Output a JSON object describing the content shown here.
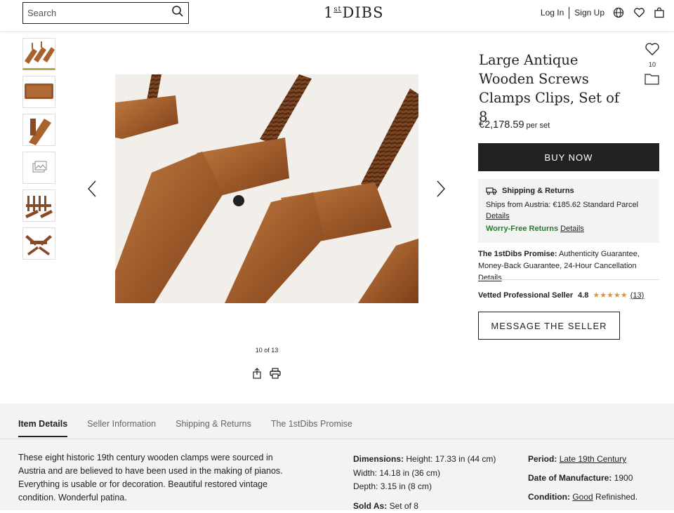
{
  "header": {
    "search_placeholder": "Search",
    "logo_main": "1",
    "logo_sup": "st",
    "logo_rest": "DIBS",
    "login": "Log In",
    "signup": "Sign Up"
  },
  "gallery": {
    "counter": "10 of 13",
    "thumb_count": 6
  },
  "product": {
    "title": "Large Antique Wooden Screws Clamps Clips, Set of 8",
    "favorites": "10",
    "price": "€2,178.59",
    "price_unit": "per set",
    "buy_label": "BUY NOW"
  },
  "shipping": {
    "heading": "Shipping & Returns",
    "ships_from": "Ships from Austria: €185.62 Standard Parcel",
    "details_link": "Details",
    "worry_free": "Worry-Free Returns",
    "worry_free_details": "Details"
  },
  "promise": {
    "label": "The 1stDibs Promise:",
    "text": "Authenticity Guarantee, Money-Back Guarantee, 24-Hour Cancellation",
    "details_link": "Details"
  },
  "seller": {
    "label": "Vetted Professional Seller",
    "rating": "4.8",
    "stars": "★★★★★",
    "review_count": "(13)",
    "message_label": "MESSAGE THE SELLER"
  },
  "details": {
    "tabs": [
      "Item Details",
      "Seller Information",
      "Shipping & Returns",
      "The 1stDibs Promise"
    ],
    "description": "These eight historic 19th century wooden clamps were sourced in Austria and are believed to have been used in the making of pianos. Everything is usable or for decoration. Beautiful restored vintage condition. Wonderful patina.",
    "dimensions_label": "Dimensions:",
    "height": "Height: 17.33 in (44 cm)",
    "width": "Width: 14.18 in (36 cm)",
    "depth": "Depth: 3.15 in (8 cm)",
    "sold_as_label": "Sold As:",
    "sold_as": "Set of 8",
    "period_label": "Period:",
    "period": "Late 19th Century",
    "date_label": "Date of Manufacture:",
    "date": "1900",
    "condition_label": "Condition:",
    "condition_link": "Good",
    "condition_rest": "Refinished."
  },
  "colors": {
    "accent": "#c4a24a",
    "wood": "#a8622e",
    "dark": "#222222",
    "green": "#2a7a2a",
    "star": "#e0962a"
  }
}
